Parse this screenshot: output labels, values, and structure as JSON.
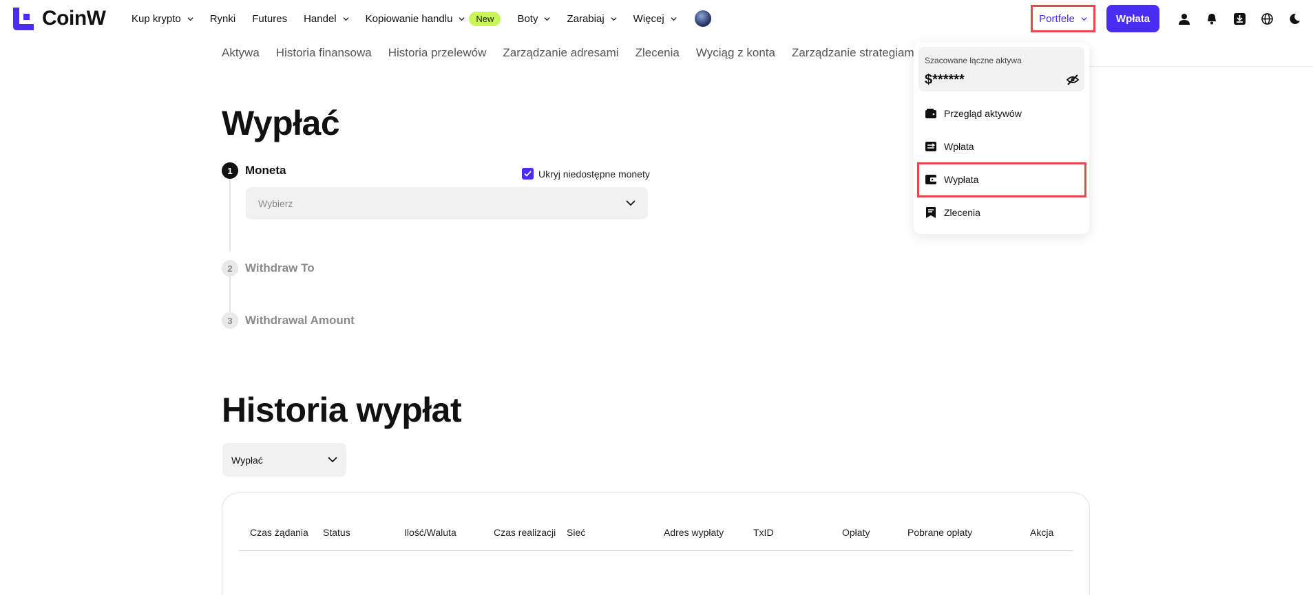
{
  "brand": {
    "name": "CoinW",
    "accent": "#4a2cf5",
    "badge_color": "#c9f55a",
    "highlight_color": "#e5484d"
  },
  "nav": {
    "items": [
      {
        "label": "Kup krypto",
        "dropdown": true
      },
      {
        "label": "Rynki",
        "dropdown": false
      },
      {
        "label": "Futures",
        "dropdown": false
      },
      {
        "label": "Handel",
        "dropdown": true
      },
      {
        "label": "Kopiowanie handlu",
        "dropdown": true
      },
      {
        "label": "Boty",
        "dropdown": true
      },
      {
        "label": "Zarabiaj",
        "dropdown": true
      },
      {
        "label": "Więcej",
        "dropdown": true
      }
    ],
    "new_badge": "New"
  },
  "header": {
    "portfele_label": "Portfele",
    "wplata_label": "Wpłata",
    "icons": [
      "user-icon",
      "bell-icon",
      "download-icon",
      "globe-icon",
      "moon-icon"
    ]
  },
  "subnav": {
    "items": [
      "Aktywa",
      "Historia finansowa",
      "Historia przelewów",
      "Zarządzanie adresami",
      "Zlecenia",
      "Wyciąg z konta",
      "Zarządzanie strategiami"
    ]
  },
  "withdraw": {
    "title": "Wypłać",
    "steps": [
      {
        "num": "1",
        "label": "Moneta"
      },
      {
        "num": "2",
        "label": "Withdraw To"
      },
      {
        "num": "3",
        "label": "Withdrawal Amount"
      }
    ],
    "hide_coins_label": "Ukryj niedostępne monety",
    "hide_coins_checked": true,
    "coin_placeholder": "Wybierz"
  },
  "history": {
    "title": "Historia wypłat",
    "filter_value": "Wypłać",
    "columns": [
      "Czas żądania",
      "Status",
      "Ilość/Waluta",
      "Czas realizacji",
      "Sieć",
      "Adres wypłaty",
      "TxID",
      "Opłaty",
      "Pobrane opłaty",
      "Akcja"
    ]
  },
  "wallet_dropdown": {
    "assets_label": "Szacowane łączne aktywa",
    "assets_value": "$******",
    "items": [
      {
        "label": "Przegląd aktywów",
        "icon": "wallet-icon"
      },
      {
        "label": "Wpłata",
        "icon": "deposit-icon"
      },
      {
        "label": "Wypłata",
        "icon": "withdraw-icon",
        "highlighted": true
      },
      {
        "label": "Zlecenia",
        "icon": "orders-icon"
      }
    ]
  }
}
